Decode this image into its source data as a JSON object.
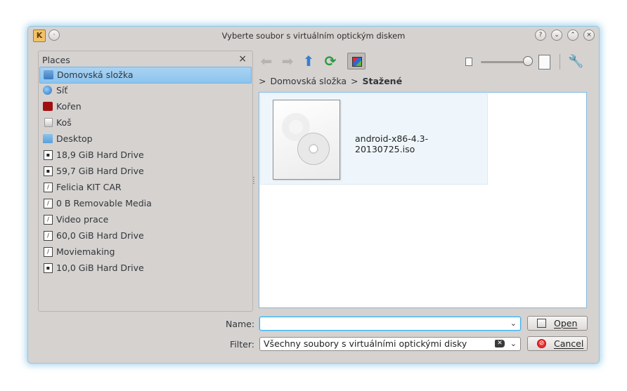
{
  "window": {
    "title": "Vyberte soubor s virtuálním optickým diskem",
    "app_icon_glyph": "K",
    "menu_glyph": "·",
    "help_glyph": "?",
    "minimize_glyph": "⌄",
    "maximize_glyph": "⌃",
    "close_glyph": "×"
  },
  "places": {
    "header": "Places",
    "close_glyph": "×",
    "items": [
      {
        "label": "Domovská složka",
        "icon": "home-folder-icon",
        "selected": true
      },
      {
        "label": "Síť",
        "icon": "network-icon"
      },
      {
        "label": "Kořen",
        "icon": "root-folder-icon"
      },
      {
        "label": "Koš",
        "icon": "trash-icon"
      },
      {
        "label": "Desktop",
        "icon": "desktop-folder-icon"
      },
      {
        "label": "18,9 GiB Hard Drive",
        "icon": "hard-drive-icon"
      },
      {
        "label": "59,7 GiB Hard Drive",
        "icon": "hard-drive-icon"
      },
      {
        "label": "Felicia KIT CAR",
        "icon": "hard-drive-icon"
      },
      {
        "label": "0 B Removable Media",
        "icon": "removable-media-icon"
      },
      {
        "label": "Video prace",
        "icon": "hard-drive-icon"
      },
      {
        "label": "60,0 GiB Hard Drive",
        "icon": "hard-drive-icon"
      },
      {
        "label": "Moviemaking",
        "icon": "hard-drive-icon"
      },
      {
        "label": "10,0 GiB Hard Drive",
        "icon": "hard-drive-icon"
      }
    ]
  },
  "toolbar": {
    "back_glyph": "⬅",
    "forward_glyph": "➡",
    "up_glyph": "⬆",
    "reload_glyph": "⟳",
    "options_glyph": "🔧"
  },
  "breadcrumb": {
    "separator": ">",
    "parent": "Domovská složka",
    "current": "Stažené"
  },
  "files": [
    {
      "name": "android-x86-4.3-20130725.iso",
      "icon": "optical-disc-image-icon"
    }
  ],
  "name_row": {
    "label": "Name:",
    "value": "",
    "arrow_glyph": "⌄"
  },
  "filter_row": {
    "label": "Filter:",
    "value": "Všechny soubory s virtuálními optickými disky",
    "clear_glyph": "✕",
    "arrow_glyph": "⌄"
  },
  "buttons": {
    "open_label": "Open",
    "cancel_label": "Cancel",
    "cancel_glyph": "⊘"
  },
  "colors": {
    "window_bg": "#d6d2d0",
    "selection": "#8cc4ee",
    "focus": "#3daee9"
  }
}
